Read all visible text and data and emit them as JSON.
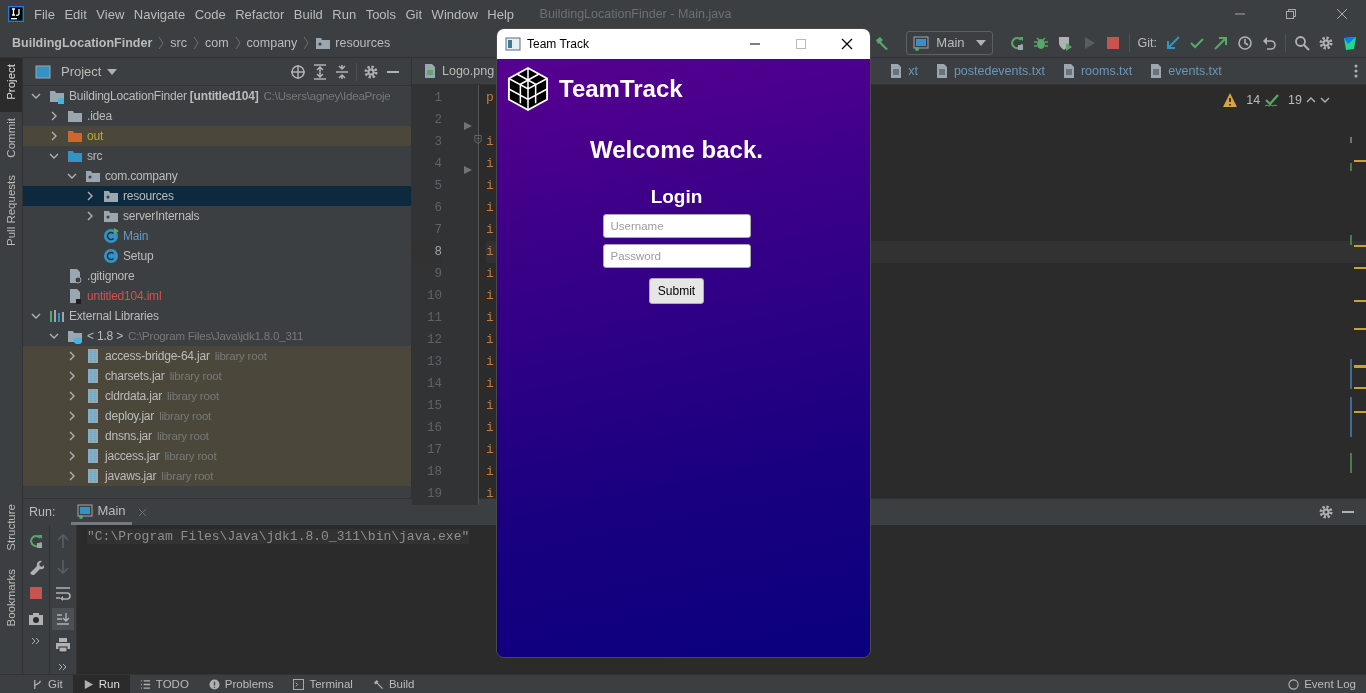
{
  "ide": {
    "menu": [
      "File",
      "Edit",
      "View",
      "Navigate",
      "Code",
      "Refactor",
      "Build",
      "Run",
      "Tools",
      "Git",
      "Window",
      "Help"
    ],
    "window_title": "BuildingLocationFinder - Main.java",
    "breadcrumbs": [
      {
        "label": "BuildingLocationFinder",
        "kind": "project"
      },
      {
        "label": "src",
        "kind": "dir"
      },
      {
        "label": "com",
        "kind": "dir"
      },
      {
        "label": "company",
        "kind": "dir"
      },
      {
        "label": "resources",
        "kind": "folder"
      }
    ],
    "run_config": "Main",
    "git_label": "Git:",
    "left_tool_tabs": [
      {
        "label": "Project",
        "selected": true
      },
      {
        "label": "Commit",
        "selected": false
      },
      {
        "label": "Pull Requests",
        "selected": false
      }
    ],
    "left_tool_tabs_bottom": [
      {
        "label": "Structure",
        "selected": false
      },
      {
        "label": "Bookmarks",
        "selected": false
      }
    ],
    "project_panel": {
      "title": "Project",
      "tree": [
        {
          "label": "BuildingLocationFinder **[untitled104]**",
          "hint": "C:\\Users\\agney\\IdeaProje",
          "kind": "module",
          "expanded": true,
          "selected": false,
          "children": [
            {
              "label": ".idea",
              "kind": "folder",
              "expanded": false,
              "selected": false
            },
            {
              "label": "out",
              "kind": "excluded",
              "color": "#b8a93a",
              "expanded": false,
              "selected": false
            },
            {
              "label": "src",
              "kind": "source",
              "expanded": true,
              "selected": false,
              "children": [
                {
                  "label": "com.company",
                  "kind": "package",
                  "expanded": true,
                  "selected": false,
                  "children": [
                    {
                      "label": "resources",
                      "kind": "package",
                      "expanded": false,
                      "selected": true
                    },
                    {
                      "label": "serverInternals",
                      "kind": "package",
                      "expanded": false,
                      "selected": false
                    },
                    {
                      "label": "Main",
                      "kind": "main_class",
                      "color": "#6897bb",
                      "selected": false
                    },
                    {
                      "label": "Setup",
                      "kind": "class",
                      "selected": false
                    }
                  ]
                }
              ]
            },
            {
              "label": ".gitignore",
              "kind": "ignore_file",
              "selected": false
            },
            {
              "label": "untitled104.iml",
              "kind": "iml_file",
              "color": "#d25252",
              "selected": false
            }
          ]
        },
        {
          "label": "External Libraries",
          "kind": "libraries",
          "expanded": true,
          "selected": false,
          "children": [
            {
              "label": "< 1.8 >",
              "hint": "C:\\Program Files\\Java\\jdk1.8.0_311",
              "kind": "jdk",
              "expanded": true,
              "selected": false,
              "children": [
                {
                  "label": "access-bridge-64.jar",
                  "hint": "library root",
                  "kind": "jar",
                  "expanded": false,
                  "selected": false
                },
                {
                  "label": "charsets.jar",
                  "hint": "library root",
                  "kind": "jar",
                  "expanded": false,
                  "selected": false
                },
                {
                  "label": "cldrdata.jar",
                  "hint": "library root",
                  "kind": "jar",
                  "expanded": false,
                  "selected": false
                },
                {
                  "label": "deploy.jar",
                  "hint": "library root",
                  "kind": "jar",
                  "expanded": false,
                  "selected": false
                },
                {
                  "label": "dnsns.jar",
                  "hint": "library root",
                  "kind": "jar",
                  "expanded": false,
                  "selected": false
                },
                {
                  "label": "jaccess.jar",
                  "hint": "library root",
                  "kind": "jar",
                  "expanded": false,
                  "selected": false
                },
                {
                  "label": "javaws.jar",
                  "hint": "library root",
                  "kind": "jar",
                  "expanded": false,
                  "selected": false
                }
              ]
            }
          ]
        }
      ]
    },
    "editor": {
      "tabs": [
        {
          "label": "Logo.png",
          "kind": "image",
          "selected": false
        },
        {
          "label": "xt",
          "kind": "text",
          "selected": false
        },
        {
          "label": "postedevents.txt",
          "kind": "text",
          "selected": false
        },
        {
          "label": "rooms.txt",
          "kind": "text",
          "selected": false
        },
        {
          "label": "events.txt",
          "kind": "text",
          "selected": false
        }
      ],
      "warnings": "14",
      "weak_warnings": "19",
      "lines": [
        {
          "number": "1",
          "text": "p",
          "current": false
        },
        {
          "number": "2",
          "current": false
        },
        {
          "number": "3",
          "text": "i",
          "current": false
        },
        {
          "number": "4",
          "text": "i",
          "current": false
        },
        {
          "number": "5",
          "text": "i",
          "current": false
        },
        {
          "number": "6",
          "text": "i",
          "current": false
        },
        {
          "number": "7",
          "text": "i",
          "current": false
        },
        {
          "number": "8",
          "text": "i",
          "current": true
        },
        {
          "number": "9",
          "text": "i",
          "current": false
        },
        {
          "number": "10",
          "text": "i",
          "current": false
        },
        {
          "number": "11",
          "text": "i",
          "current": false
        },
        {
          "number": "12",
          "text": "i",
          "current": false
        },
        {
          "number": "13",
          "text": "i",
          "current": false
        },
        {
          "number": "14",
          "text": "i",
          "current": false
        },
        {
          "number": "15",
          "text": "i",
          "current": false
        },
        {
          "number": "16",
          "text": "i",
          "current": false
        },
        {
          "number": "17",
          "text": "i",
          "current": false
        },
        {
          "number": "18",
          "text": "i",
          "current": false
        },
        {
          "number": "19",
          "text": "i",
          "current": false
        }
      ]
    },
    "run_panel": {
      "title": "Run:",
      "tab": "Main",
      "console": "\"C:\\Program Files\\Java\\jdk1.8.0_311\\bin\\java.exe\""
    },
    "bottom_tabs": [
      {
        "label": "Git",
        "kind": "git",
        "selected": false
      },
      {
        "label": "Run",
        "kind": "run",
        "selected": true
      },
      {
        "label": "TODO",
        "kind": "todo",
        "selected": false
      },
      {
        "label": "Problems",
        "kind": "problems",
        "selected": false
      },
      {
        "label": "Terminal",
        "kind": "terminal",
        "selected": false
      },
      {
        "label": "Build",
        "kind": "build",
        "selected": false
      }
    ],
    "event_log": "Event Log"
  },
  "dialog": {
    "title": "Team Track",
    "app_name": "TeamTrack",
    "heading": "Welcome back.",
    "form_title": "Login",
    "fields": [
      {
        "placeholder": "Username"
      },
      {
        "placeholder": "Password"
      }
    ],
    "submit": "Submit"
  }
}
